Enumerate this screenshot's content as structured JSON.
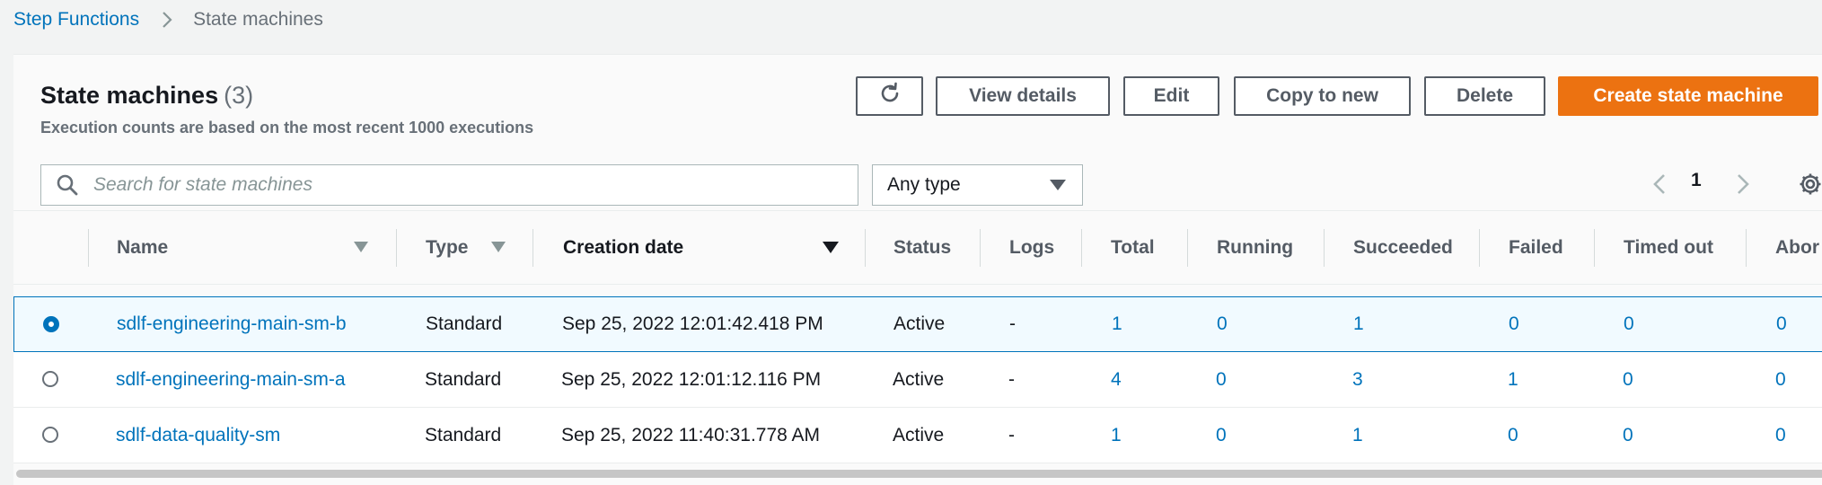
{
  "breadcrumb": {
    "root": "Step Functions",
    "current": "State machines"
  },
  "panel": {
    "title": "State machines",
    "count": "(3)",
    "description": "Execution counts are based on the most recent 1000 executions"
  },
  "actions": {
    "view_details": "View details",
    "edit": "Edit",
    "copy": "Copy to new",
    "delete": "Delete",
    "create": "Create state machine"
  },
  "search": {
    "placeholder": "Search for state machines"
  },
  "type_filter": {
    "selected": "Any type"
  },
  "pagination": {
    "page": "1"
  },
  "columns": [
    "Name",
    "Type",
    "Creation date",
    "Status",
    "Logs",
    "Total",
    "Running",
    "Succeeded",
    "Failed",
    "Timed out",
    "Abor"
  ],
  "rows": [
    {
      "name": "sdlf-engineering-main-sm-b",
      "type": "Standard",
      "created": "Sep 25, 2022 12:01:42.418 PM",
      "status": "Active",
      "logs": "-",
      "total": "1",
      "running": "0",
      "succeeded": "1",
      "failed": "0",
      "timed_out": "0",
      "aborted": "0",
      "selected": true
    },
    {
      "name": "sdlf-engineering-main-sm-a",
      "type": "Standard",
      "created": "Sep 25, 2022 12:01:12.116 PM",
      "status": "Active",
      "logs": "-",
      "total": "4",
      "running": "0",
      "succeeded": "3",
      "failed": "1",
      "timed_out": "0",
      "aborted": "0",
      "selected": false
    },
    {
      "name": "sdlf-data-quality-sm",
      "type": "Standard",
      "created": "Sep 25, 2022 11:40:31.778 AM",
      "status": "Active",
      "logs": "-",
      "total": "1",
      "running": "0",
      "succeeded": "1",
      "failed": "0",
      "timed_out": "0",
      "aborted": "0",
      "selected": false
    }
  ],
  "colors": {
    "link": "#0073bb",
    "primary": "#ec7211",
    "selected_row_bg": "#f1faff",
    "border": "#aab7b8"
  },
  "icons": {
    "breadcrumb_separator": "chevron-right-icon",
    "refresh": "refresh-icon",
    "search": "search-icon",
    "select": "caret-down-icon",
    "prev": "chevron-left-icon",
    "next": "chevron-right-icon",
    "settings": "gear-icon",
    "sort": "sort-caret-icon"
  }
}
